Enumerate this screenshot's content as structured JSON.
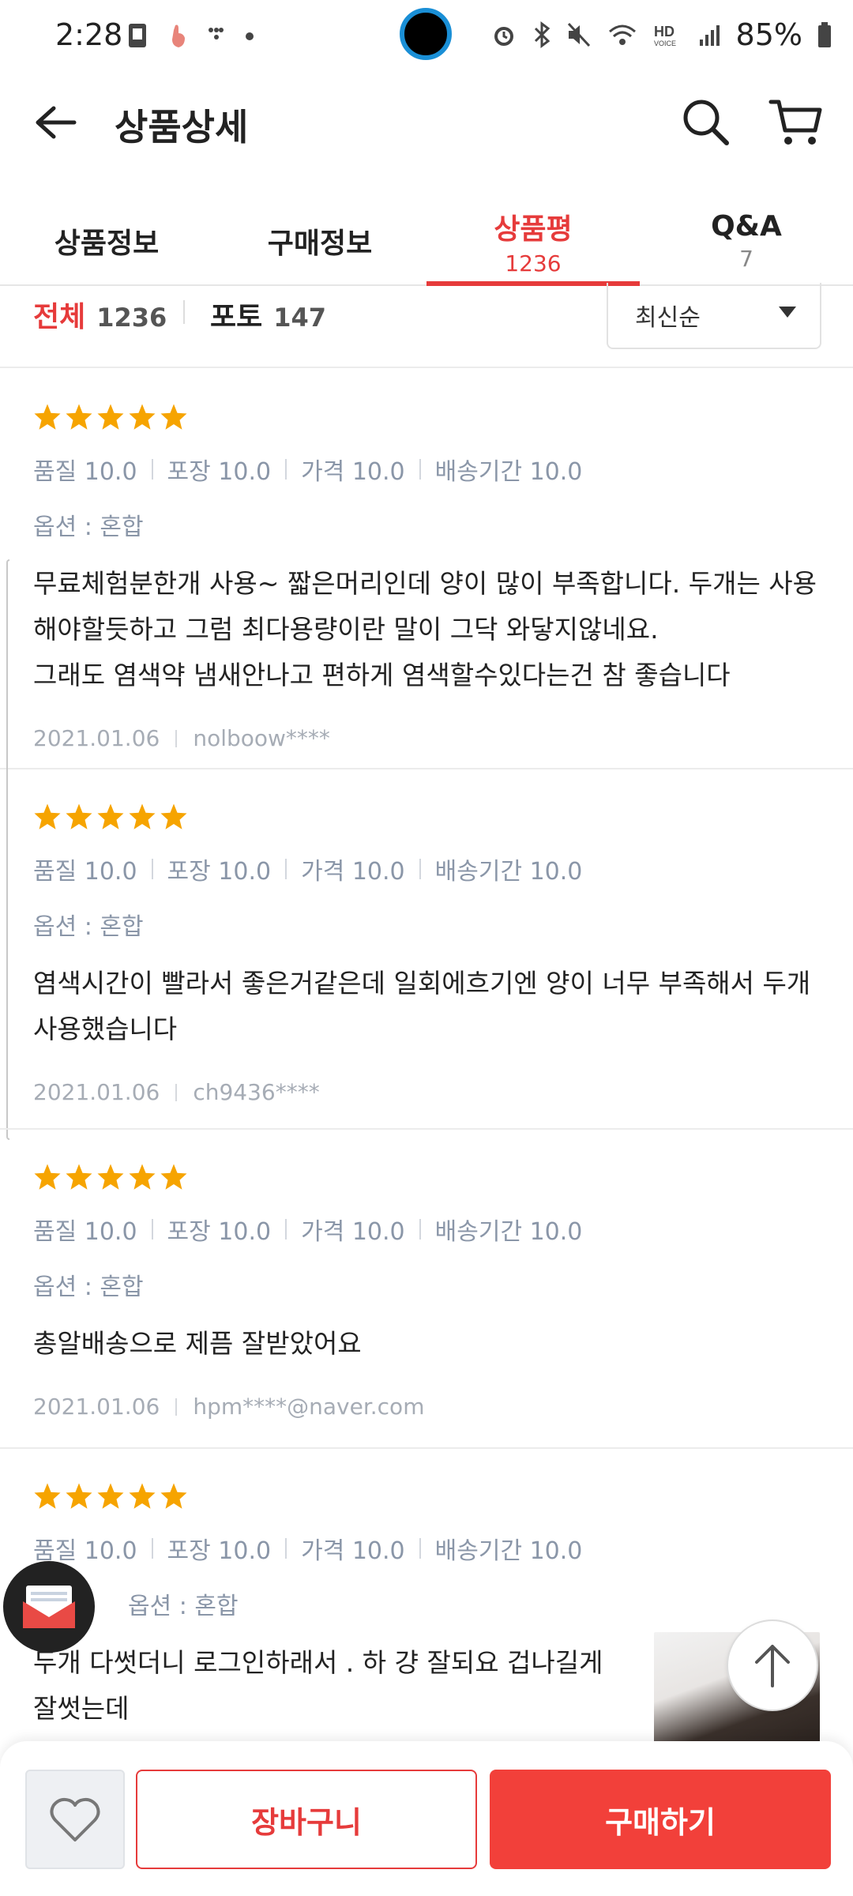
{
  "status_bar": {
    "time": "2:28",
    "battery": "85%",
    "icons": [
      "sim-icon",
      "hand-icon",
      "signal-dots-icon",
      "dot-icon",
      "alarm-icon",
      "bluetooth-icon",
      "mute-icon",
      "wifi-icon",
      "hd-voice-icon",
      "cell-signal-icon",
      "battery-icon"
    ]
  },
  "header": {
    "title": "상품상세"
  },
  "tabs": [
    {
      "label": "상품정보",
      "count": ""
    },
    {
      "label": "구매정보",
      "count": ""
    },
    {
      "label": "상품평",
      "count": "1236"
    },
    {
      "label": "Q&A",
      "count": "7"
    }
  ],
  "filter": {
    "all_label": "전체",
    "all_count": "1236",
    "photo_label": "포토",
    "photo_count": "147",
    "sort_label": "최신순"
  },
  "reviews": [
    {
      "rating": 5,
      "scores": [
        "품질 10.0",
        "포장 10.0",
        "가격 10.0",
        "배송기간 10.0"
      ],
      "option": "옵션 : 혼합",
      "text": "무료체험분한개 사용~ 짧은머리인데 양이 많이 부족합니다. 두개는 사용해야할듯하고 그럼 최다용량이란 말이 그닥 와닿지않네요.\n그래도 염색약 냄새안나고 편하게 염색할수있다는건 참 좋습니다",
      "date": "2021.01.06",
      "user": "nolboow****"
    },
    {
      "rating": 5,
      "scores": [
        "품질 10.0",
        "포장 10.0",
        "가격 10.0",
        "배송기간 10.0"
      ],
      "option": "옵션 : 혼합",
      "text": "염색시간이 빨라서 좋은거같은데 일회에흐기엔 양이 너무 부족해서 두개사용했습니다",
      "date": "2021.01.06",
      "user": "ch9436****"
    },
    {
      "rating": 5,
      "scores": [
        "품질 10.0",
        "포장 10.0",
        "가격 10.0",
        "배송기간 10.0"
      ],
      "option": "옵션 : 혼합",
      "text": "총알배송으로 제픔 잘받았어요",
      "date": "2021.01.06",
      "user": "hpm****@naver.com"
    },
    {
      "rating": 5,
      "scores": [
        "품질 10.0",
        "포장 10.0",
        "가격 10.0",
        "배송기간 10.0"
      ],
      "option": "옵션 : 혼합",
      "text": "두개 다썻더니 로그인하래서 . 하 걍 잘되요 겁나길게\n잘썻는데",
      "date": "",
      "user": ""
    }
  ],
  "bottom_bar": {
    "cart_label": "장바구니",
    "buy_label": "구매하기"
  },
  "colors": {
    "accent": "#e63b3b",
    "buy_button": "#f2403a",
    "star": "#f6a400",
    "muted_text": "#8a96a8"
  }
}
